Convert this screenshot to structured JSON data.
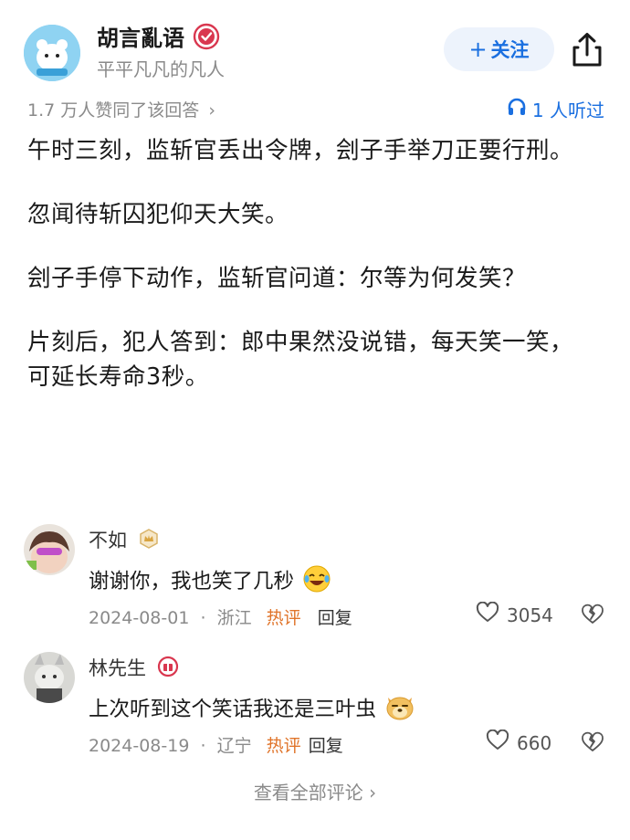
{
  "author": {
    "name": "胡言亂语",
    "bio": "平平凡凡的凡人"
  },
  "follow_button": {
    "icon": "+",
    "label": "关注"
  },
  "meta": {
    "likes_text": "1.7 万人赞同了该回答",
    "likes_chevron": "›",
    "listen_text": "1 人听过"
  },
  "answer": {
    "paragraphs": [
      "午时三刻，监斩官丢出令牌，刽子手举刀正要行刑。",
      "忽闻待斩囚犯仰天大笑。",
      "刽子手停下动作，监斩官问道：尔等为何发笑？",
      "片刻后，犯人答到：郎中果然没说错，每天笑一笑，可延长寿命3秒。"
    ]
  },
  "comments": [
    {
      "name": "不如",
      "text": "谢谢你，我也笑了几秒",
      "date": "2024-08-01",
      "location": "浙江",
      "hot": "热评",
      "reply": "回复",
      "likes": "3054"
    },
    {
      "name": "林先生",
      "text": "上次听到这个笑话我还是三叶虫",
      "date": "2024-08-19",
      "location": "辽宁",
      "hot": "热评",
      "reply": "回复",
      "likes": "660"
    }
  ],
  "separator": "·",
  "view_all": "查看全部评论 ›",
  "colors": {
    "accent": "#1a6fe0",
    "follow_bg": "#edf3fc",
    "hot": "#e0742a",
    "muted": "#8a8a8a",
    "verify": "#d9374f"
  },
  "icons": {
    "verify": "verified-badge-icon",
    "share": "share-icon",
    "listen": "headphones-icon",
    "like": "heart-icon",
    "dislike": "broken-heart-icon"
  }
}
